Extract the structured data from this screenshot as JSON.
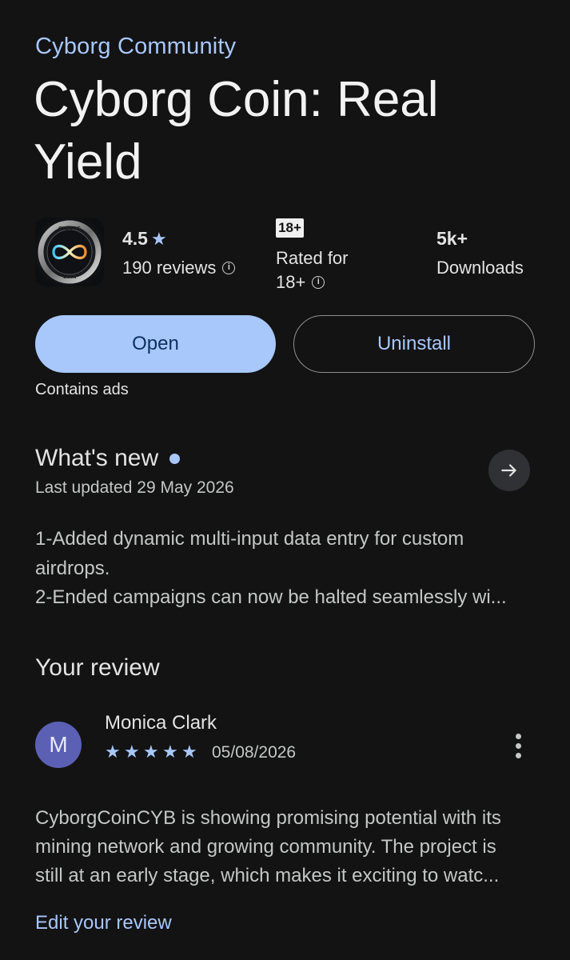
{
  "app": {
    "developer": "Cyborg Community",
    "title": "Cyborg Coin: Real Yield",
    "icon_name": "cyborg-coin-app-icon"
  },
  "stats": {
    "rating_value": "4.5",
    "rating_star": "★",
    "reviews_label": "190 reviews",
    "age_badge": "18+",
    "age_label_line1": "Rated for",
    "age_label_line2": "18+",
    "downloads_value": "5k+",
    "downloads_label": "Downloads"
  },
  "actions": {
    "open_label": "Open",
    "uninstall_label": "Uninstall",
    "contains_ads": "Contains ads"
  },
  "whats_new": {
    "title": "What's new",
    "updated": "Last updated 29 May 2026",
    "lines": [
      "1-Added dynamic multi-input data entry for custom",
      "airdrops.",
      "2-Ended campaigns can now be halted seamlessly wi..."
    ]
  },
  "your_review": {
    "title": "Your review",
    "avatar_letter": "M",
    "reviewer_name": "Monica Clark",
    "stars": 5,
    "date": "05/08/2026",
    "body_lines": [
      "CyborgCoinCYB is showing promising potential with its",
      "mining network and growing community. The project is",
      "still at an early stage, which makes it exciting to watc..."
    ],
    "edit_label": "Edit your review"
  },
  "colors": {
    "background": "#131314",
    "accent": "#a8c7fa",
    "avatar": "#5b60b5"
  }
}
